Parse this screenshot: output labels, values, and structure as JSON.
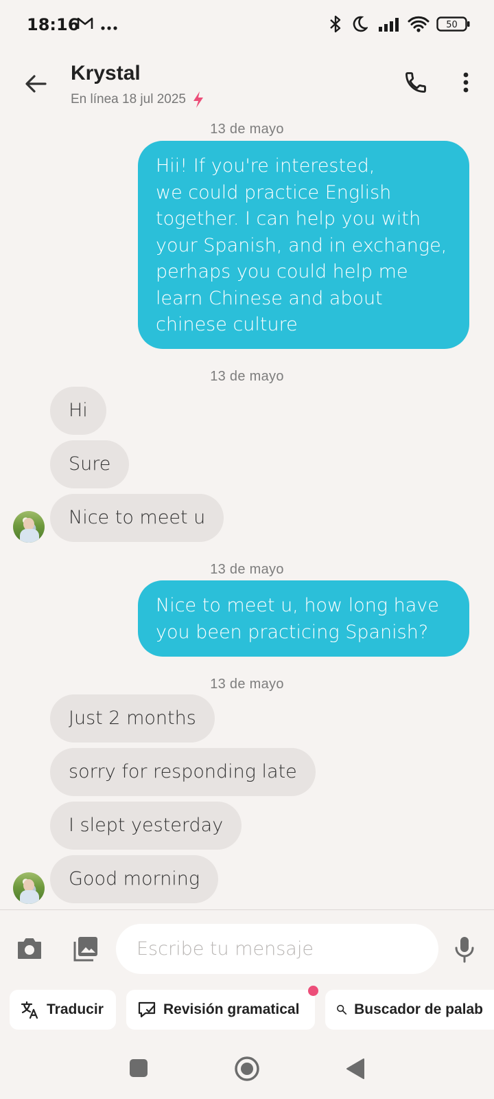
{
  "status_bar": {
    "time": "18:16",
    "battery": "50",
    "icons": [
      "gmail-icon",
      "more-dots-icon",
      "bluetooth-icon",
      "moon-icon",
      "signal-icon",
      "wifi-icon",
      "battery-icon"
    ]
  },
  "header": {
    "contact_name": "Krystal",
    "status_text": "En línea 18 jul 2025",
    "status_accent": "#ec4e79"
  },
  "messages": {
    "date_1": "13 de mayo",
    "out_1": "Hii! If you're interested,\nwe could practice English together. I can help you with your Spanish, and in exchange, perhaps you could help me learn Chinese and about chinese culture",
    "date_2": "13 de mayo",
    "in_1": "Hi",
    "in_2": "Sure",
    "in_3": "Nice to meet u",
    "date_3": "13 de mayo",
    "out_2": "Nice to meet u, how long have you been practicing Spanish?",
    "date_4": "13 de mayo",
    "in_4": "Just 2 months",
    "in_5": "sorry for responding late",
    "in_6": "I slept yesterday",
    "in_7": "Good morning"
  },
  "composer": {
    "placeholder": "Escribe tu mensaje",
    "value": ""
  },
  "chips": {
    "translate": "Traducir",
    "grammar": "Revisión gramatical",
    "search": "Buscador de palab"
  },
  "colors": {
    "outgoing_bubble": "#2bbfd9",
    "incoming_bubble": "#e7e3e1",
    "background": "#f6f3f1",
    "notification_dot": "#ec4e79"
  }
}
